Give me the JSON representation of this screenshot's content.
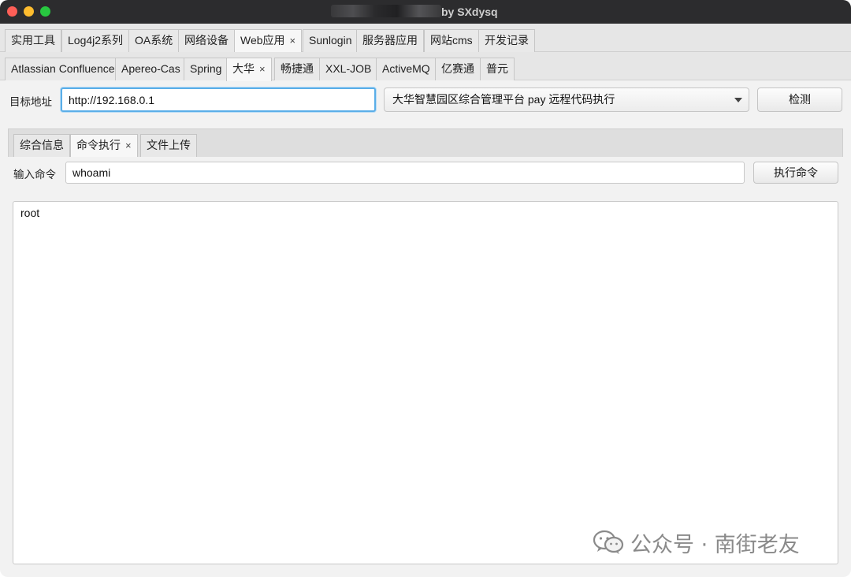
{
  "window": {
    "title_suffix": "by SXdysq"
  },
  "main_tabs": [
    {
      "label": "实用工具"
    },
    {
      "label": "Log4j2系列"
    },
    {
      "label": "OA系统"
    },
    {
      "label": "网络设备"
    },
    {
      "label": "Web应用",
      "closable": true,
      "active": true
    },
    {
      "label": "Sunlogin"
    },
    {
      "label": "服务器应用"
    },
    {
      "label": "网站cms"
    },
    {
      "label": "开发记录"
    }
  ],
  "sub_tabs": [
    {
      "label": "Atlassian Confluence"
    },
    {
      "label": "Apereo-Cas"
    },
    {
      "label": "Spring"
    },
    {
      "label": "大华",
      "closable": true,
      "active": true
    },
    {
      "label": "畅捷通"
    },
    {
      "label": "XXL-JOB"
    },
    {
      "label": "ActiveMQ"
    },
    {
      "label": "亿赛通"
    },
    {
      "label": "普元"
    }
  ],
  "target": {
    "label": "目标地址",
    "value": "http://192.168.0.1",
    "vuln_selected": "大华智慧园区综合管理平台 pay 远程代码执行",
    "detect_button": "检测"
  },
  "panel_tabs": [
    {
      "label": "综合信息"
    },
    {
      "label": "命令执行",
      "closable": true,
      "active": true
    },
    {
      "label": "文件上传"
    }
  ],
  "command": {
    "label": "输入命令",
    "value": "whoami",
    "execute_button": "执行命令"
  },
  "output": {
    "text": "root"
  },
  "watermark": {
    "text": "公众号 · 南街老友"
  },
  "colors": {
    "close": "#fe5f57",
    "minimize": "#febc2e",
    "maximize": "#28c840",
    "focus_ring": "#5aaee8"
  },
  "icons": {
    "close_tab": "×",
    "dropdown": "chevron-down-icon",
    "watermark_logo": "wechat-icon"
  }
}
